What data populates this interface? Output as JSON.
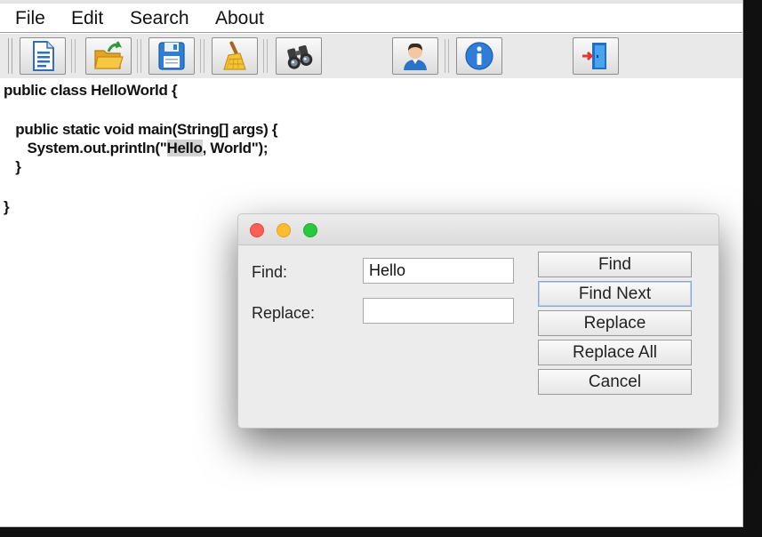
{
  "menubar": {
    "items": [
      {
        "label": "File"
      },
      {
        "label": "Edit"
      },
      {
        "label": "Search"
      },
      {
        "label": "About"
      }
    ]
  },
  "toolbar": {
    "buttons": [
      {
        "icon": "new-document-icon"
      },
      {
        "icon": "open-folder-icon"
      },
      {
        "icon": "save-floppy-icon"
      },
      {
        "icon": "clear-broom-icon"
      },
      {
        "icon": "find-binoculars-icon"
      },
      {
        "icon": "user-icon"
      },
      {
        "icon": "info-icon"
      },
      {
        "icon": "exit-door-icon"
      }
    ]
  },
  "editor": {
    "lines": [
      {
        "text": "public class HelloWorld {"
      },
      {
        "text": ""
      },
      {
        "text": "   public static void main(String[] args) {"
      },
      {
        "before": "      System.out.println(\"",
        "match": "Hello",
        "after": ", World\");"
      },
      {
        "text": "   }"
      },
      {
        "text": ""
      },
      {
        "text": "}"
      }
    ]
  },
  "dialog": {
    "find_label": "Find:",
    "find_value": "Hello",
    "replace_label": "Replace:",
    "replace_value": "",
    "buttons": {
      "find": "Find",
      "find_next": "Find Next",
      "replace": "Replace",
      "replace_all": "Replace All",
      "cancel": "Cancel"
    }
  },
  "colors": {
    "close": "#fe5f57",
    "minimize": "#febc2e",
    "zoom": "#28c840",
    "highlight": "#d2d2d2"
  }
}
